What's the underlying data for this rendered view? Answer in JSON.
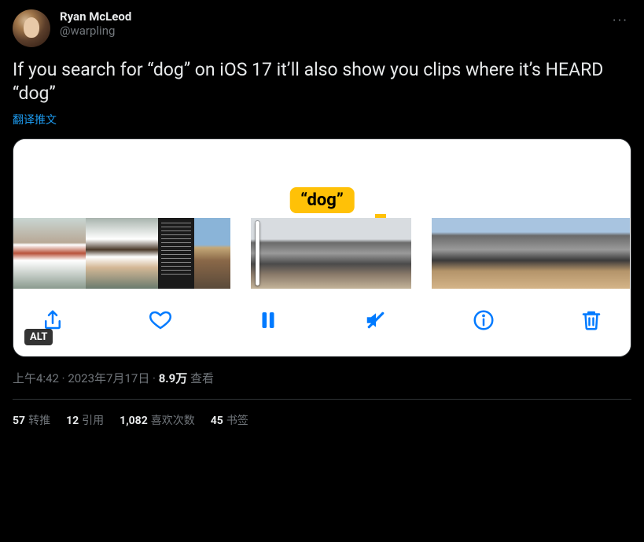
{
  "author": {
    "display_name": "Ryan McLeod",
    "handle": "@warpling"
  },
  "tweet_text": "If you search for “dog” on iOS 17 it’ll also show you clips where it’s HEARD “dog”",
  "translate_label": "翻译推文",
  "media": {
    "search_badge": "“dog”",
    "alt_badge": "ALT"
  },
  "meta": {
    "time": "上午4:42",
    "date": "2023年7月17日",
    "views_count": "8.9万",
    "views_label": "查看",
    "separator": " · "
  },
  "stats": {
    "retweets": {
      "count": "57",
      "label": "转推"
    },
    "quotes": {
      "count": "12",
      "label": "引用"
    },
    "likes": {
      "count": "1,082",
      "label": "喜欢次数"
    },
    "bookmarks": {
      "count": "45",
      "label": "书签"
    }
  },
  "icons": {
    "more": "···"
  }
}
